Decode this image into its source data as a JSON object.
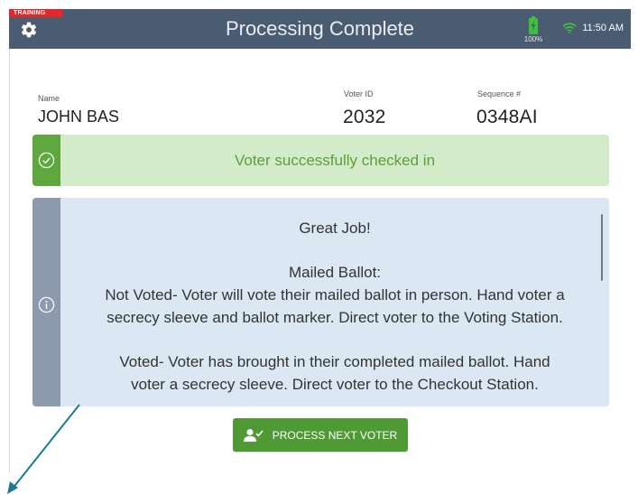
{
  "header": {
    "training_label": "TRAINING",
    "title": "Processing Complete",
    "battery_percent": "100%",
    "time": "11:50 AM"
  },
  "voter": {
    "name_label": "Name",
    "name": "JOHN BAS",
    "id_label": "Voter ID",
    "id": "2032",
    "sequence_label": "Sequence #",
    "sequence": "0348AI"
  },
  "success": {
    "message": "Voter successfully checked in"
  },
  "info": {
    "line1": "Great Job!",
    "line2": "Mailed Ballot:",
    "line3": "Not Voted- Voter will vote their mailed ballot in person. Hand voter a",
    "line4": "secrecy sleeve and ballot marker. Direct voter to the Voting Station.",
    "line5": "Voted- Voter has brought in their completed mailed ballot. Hand",
    "line6": "voter a secrecy sleeve. Direct voter to the Checkout Station."
  },
  "actions": {
    "process_next_label": "PROCESS NEXT VOTER"
  },
  "colors": {
    "header_bg": "#4a5c72",
    "training_red": "#e0282d",
    "success_green": "#5ea83f",
    "success_bg": "#d4ebc9",
    "info_bg": "#dbe8f3",
    "button_green": "#4f9a35",
    "annotation_arrow": "#1a7a93"
  },
  "icons": [
    "gear-icon",
    "battery-charging-icon",
    "wifi-icon",
    "check-circle-icon",
    "info-circle-icon",
    "add-user-icon"
  ]
}
